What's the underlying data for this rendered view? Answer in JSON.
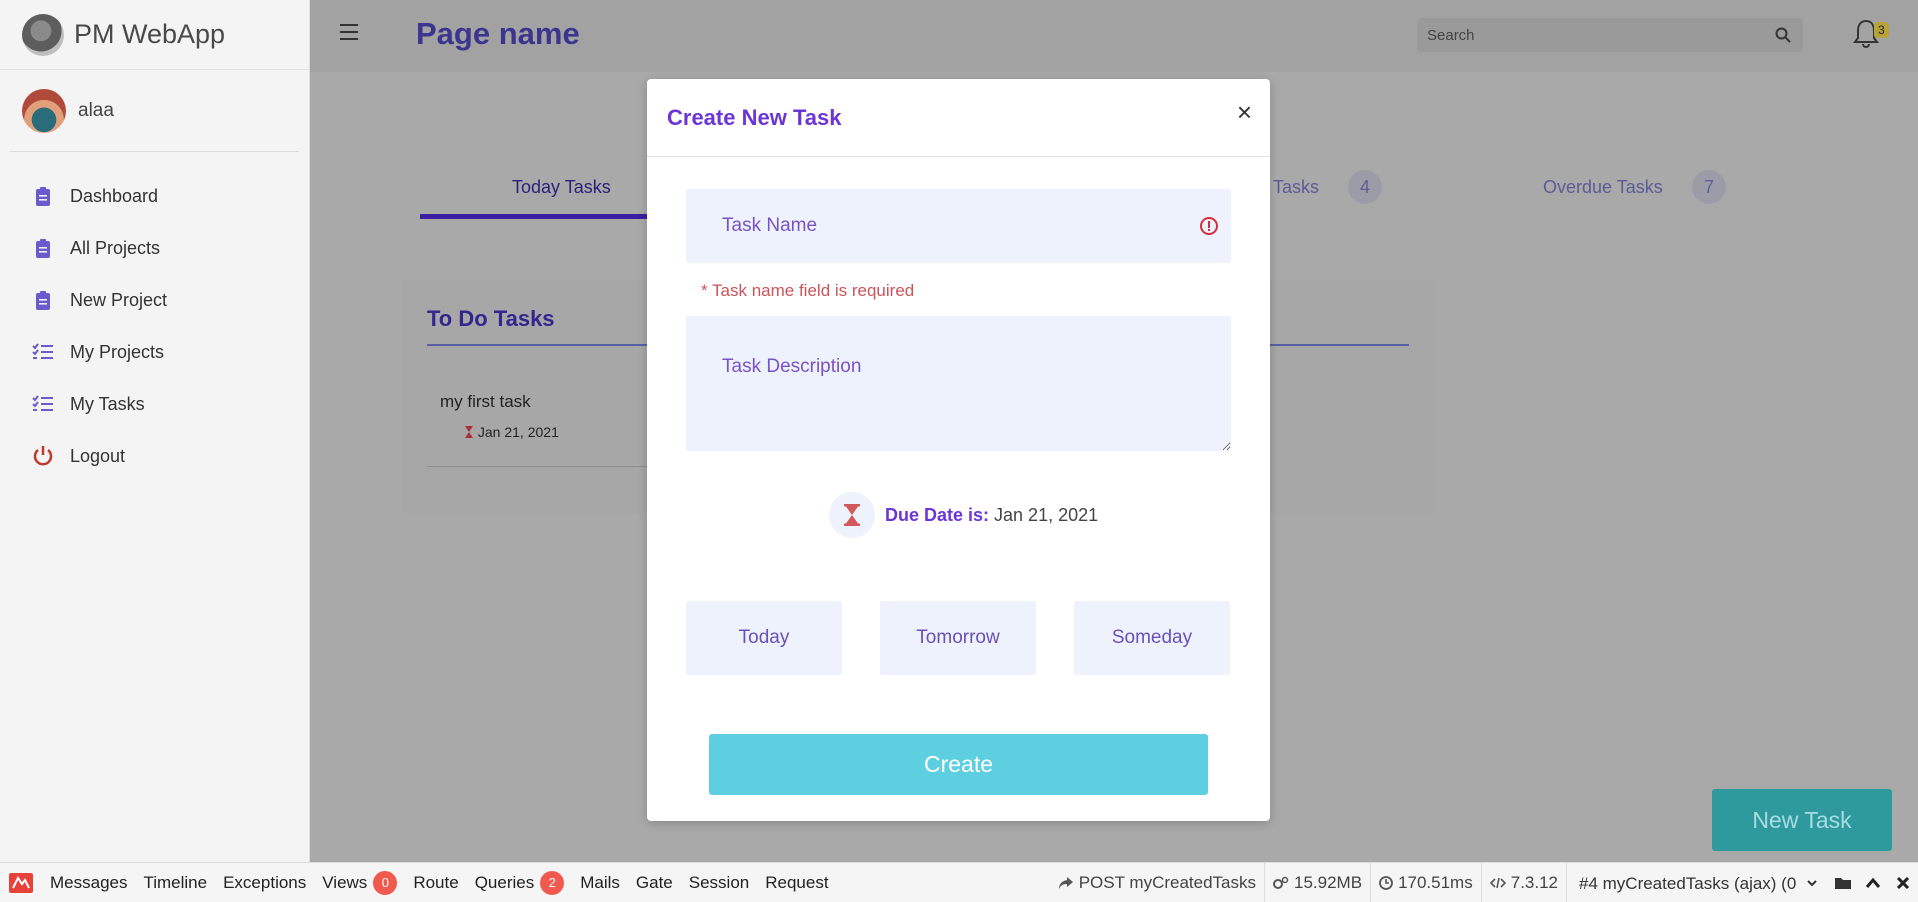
{
  "brand": {
    "name": "PM WebApp"
  },
  "user": {
    "name": "alaa"
  },
  "sidebar": {
    "items": [
      {
        "label": "Dashboard",
        "icon": "clipboard-icon"
      },
      {
        "label": "All Projects",
        "icon": "clipboard-icon"
      },
      {
        "label": "New Project",
        "icon": "clipboard-icon"
      },
      {
        "label": "My Projects",
        "icon": "checklist-icon"
      },
      {
        "label": "My Tasks",
        "icon": "checklist-icon"
      },
      {
        "label": "Logout",
        "icon": "power-icon"
      }
    ]
  },
  "topbar": {
    "page_title": "Page name",
    "search_placeholder": "Search",
    "notification_count": "3"
  },
  "tabs": [
    {
      "label": "Today Tasks"
    },
    {
      "label": "Tasks",
      "count": "4"
    },
    {
      "label": "Overdue Tasks",
      "count": "7"
    }
  ],
  "todo_card": {
    "title": "To Do Tasks",
    "task": {
      "name": "my first task",
      "date": "Jan 21, 2021"
    }
  },
  "new_task_label": "New Task",
  "modal": {
    "title": "Create New Task",
    "close": "×",
    "task_name_placeholder": "Task Name",
    "task_name_value": "",
    "error": "* Task name field is required",
    "task_description_placeholder": "Task Description",
    "due_label": "Due Date is:",
    "due_value": "Jan 21, 2021",
    "date_buttons": [
      "Today",
      "Tomorrow",
      "Someday"
    ],
    "create_label": "Create"
  },
  "debugbar": {
    "items": [
      "Messages",
      "Timeline",
      "Exceptions",
      "Views",
      "Route",
      "Queries",
      "Mails",
      "Gate",
      "Session",
      "Request"
    ],
    "views_count": "0",
    "queries_count": "2",
    "request": "POST myCreatedTasks",
    "memory": "15.92MB",
    "time": "170.51ms",
    "php_version": "7.3.12",
    "request_select": "#4 myCreatedTasks (ajax) (0"
  },
  "colors": {
    "accent": "#6c36d6",
    "create_button": "#5ecfe0",
    "error": "#c9545a",
    "field_bg": "#eef2fc"
  }
}
